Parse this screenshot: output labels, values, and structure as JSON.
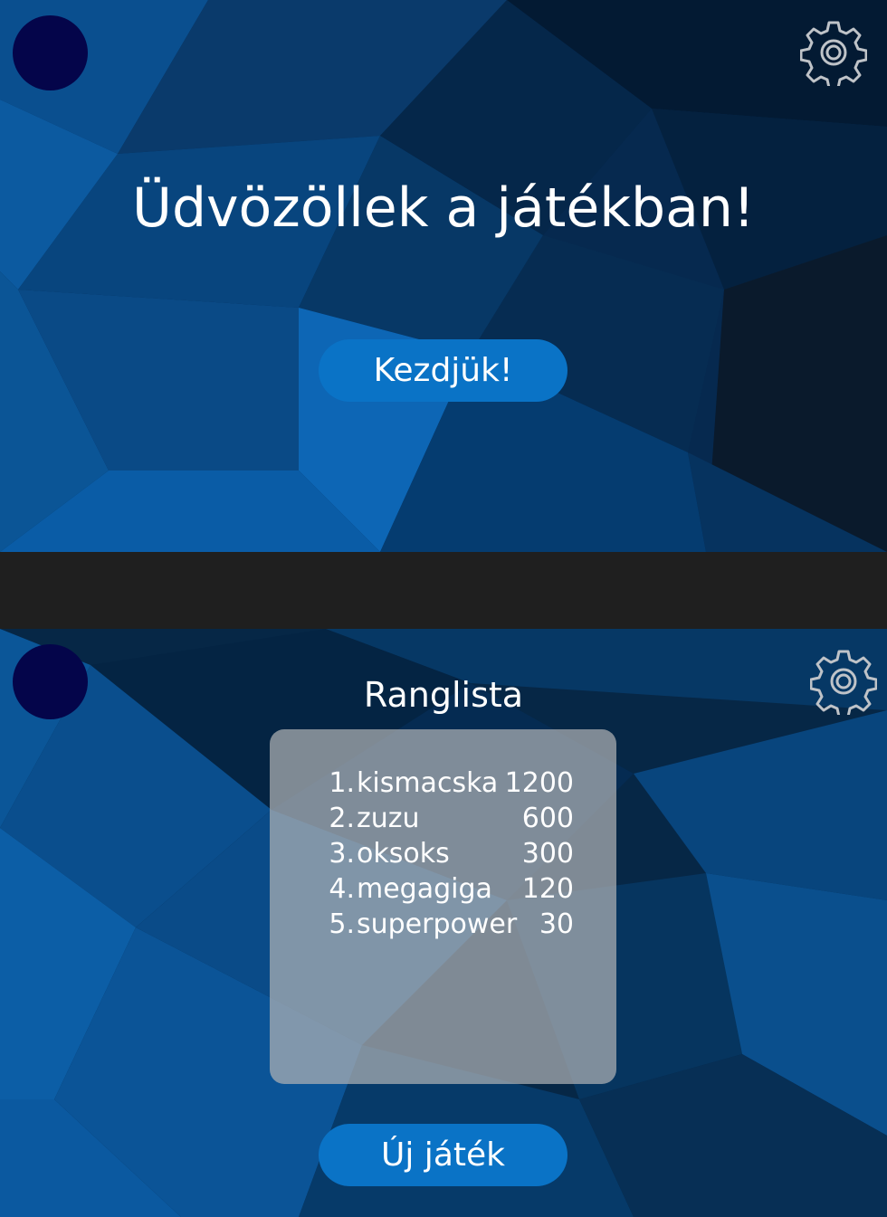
{
  "colors": {
    "background_dark": "#041a33",
    "accent_button": "#0a73c6",
    "avatar": "#04054a",
    "gear_stroke": "#bfc3c8",
    "divider": "#1f1f1f"
  },
  "welcome_screen": {
    "title": "Üdvözöllek a játékban!",
    "start_button_label": "Kezdjük!",
    "settings_icon": "gear-icon",
    "avatar": "avatar-circle"
  },
  "leaderboard_screen": {
    "title": "Ranglista",
    "entries": [
      {
        "rank": "1.",
        "name": "kismacska",
        "score": "1200"
      },
      {
        "rank": "2.",
        "name": "zuzu",
        "score": "600"
      },
      {
        "rank": "3.",
        "name": "oksoks",
        "score": "300"
      },
      {
        "rank": "4.",
        "name": "megagiga",
        "score": "120"
      },
      {
        "rank": "5.",
        "name": "superpower",
        "score": "30"
      }
    ],
    "new_game_button_label": "Új játék",
    "settings_icon": "gear-icon",
    "avatar": "avatar-circle"
  }
}
